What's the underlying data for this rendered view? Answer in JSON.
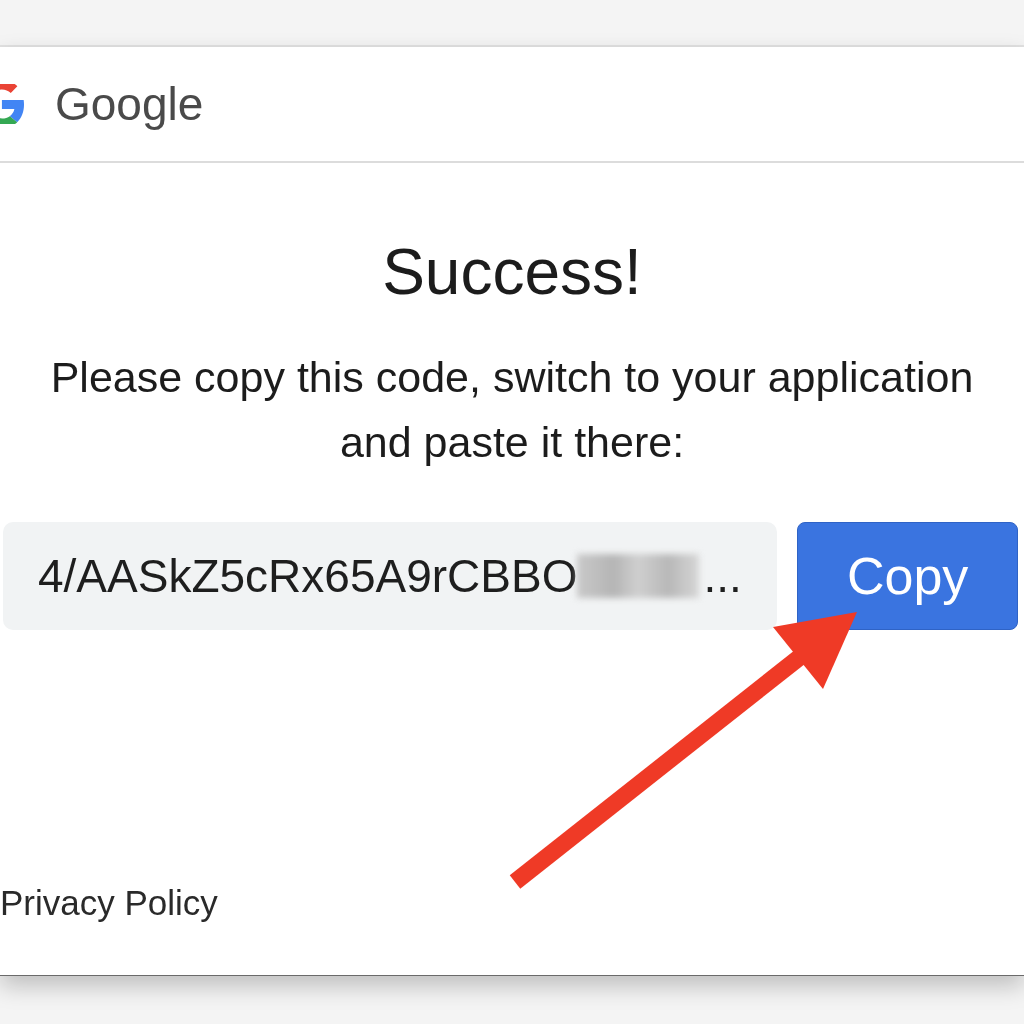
{
  "header": {
    "logo_text": "Google"
  },
  "main": {
    "title": "Success!",
    "message": "Please copy this code, switch to your application and paste it there:",
    "code_field": {
      "value": "4/AASkZ5cRx65A9rCBBO",
      "redacted": true,
      "ellipsis": "..."
    },
    "copy_button": {
      "label": "Copy"
    }
  },
  "footer": {
    "link": "Privacy Policy"
  },
  "annotations": [
    {
      "kind": "arrow"
    }
  ]
}
